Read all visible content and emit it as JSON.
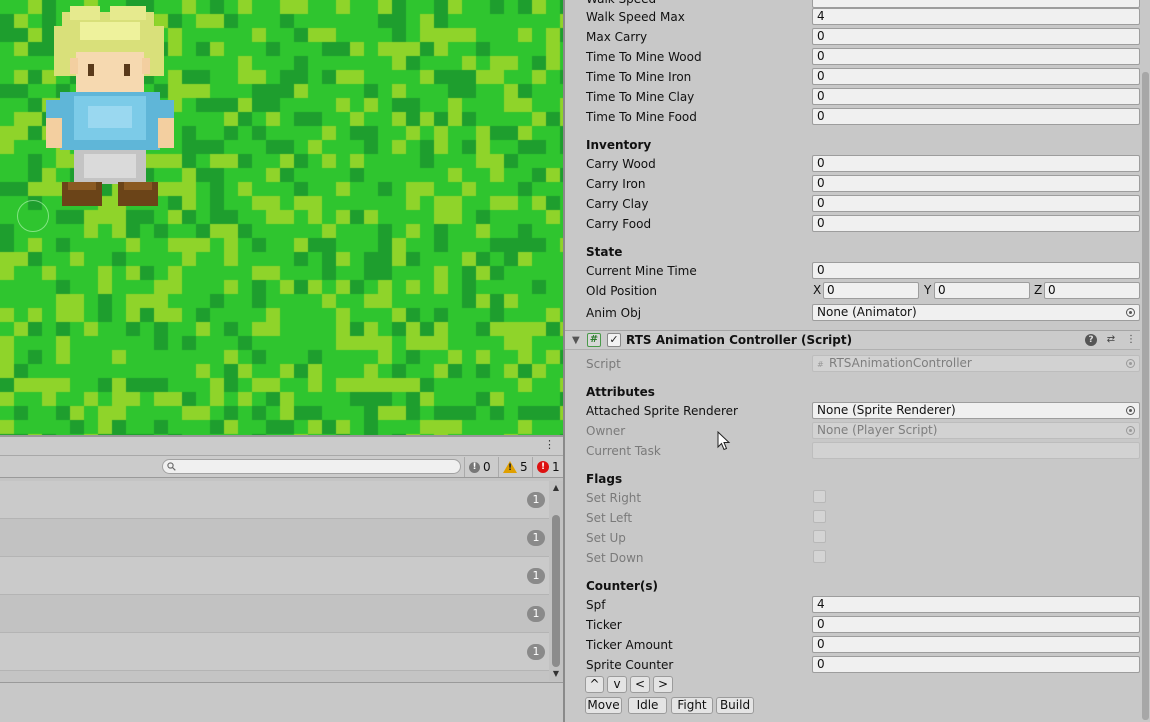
{
  "scene": {
    "colors": {
      "grass_base": "#2fc52f",
      "grass_light": "#8fd42a",
      "grass_dark": "#1e9e2e"
    }
  },
  "console": {
    "search": {
      "placeholder": ""
    },
    "counts": {
      "info": "0",
      "warnings": "5",
      "errors": "1"
    },
    "rows": [
      {
        "count": "1"
      },
      {
        "count": "1"
      },
      {
        "count": "1"
      },
      {
        "count": "1"
      },
      {
        "count": "1"
      }
    ]
  },
  "inspector": {
    "top_fields": [
      {
        "label": "Walk Speed",
        "value": ""
      },
      {
        "label": "Walk Speed Max",
        "value": "4"
      },
      {
        "label": "Max Carry",
        "value": "0"
      },
      {
        "label": "Time To Mine Wood",
        "value": "0"
      },
      {
        "label": "Time To Mine Iron",
        "value": "0"
      },
      {
        "label": "Time To Mine Clay",
        "value": "0"
      },
      {
        "label": "Time To Mine Food",
        "value": "0"
      }
    ],
    "inventory": {
      "header": "Inventory",
      "fields": [
        {
          "label": "Carry Wood",
          "value": "0"
        },
        {
          "label": "Carry Iron",
          "value": "0"
        },
        {
          "label": "Carry Clay",
          "value": "0"
        },
        {
          "label": "Carry Food",
          "value": "0"
        }
      ]
    },
    "state": {
      "header": "State",
      "current_mine_time": {
        "label": "Current Mine Time",
        "value": "0"
      },
      "old_position": {
        "label": "Old Position",
        "x_label": "X",
        "x": "0",
        "y_label": "Y",
        "y": "0",
        "z_label": "Z",
        "z": "0"
      },
      "anim_obj": {
        "label": "Anim Obj",
        "value": "None (Animator)"
      }
    },
    "component": {
      "title": "RTS Animation Controller (Script)",
      "enabled": "✓",
      "script": {
        "label": "Script",
        "value": "RTSAnimationController"
      },
      "attributes": {
        "header": "Attributes",
        "attached_sprite_renderer": {
          "label": "Attached Sprite Renderer",
          "value": "None (Sprite Renderer)"
        },
        "owner": {
          "label": "Owner",
          "value": "None (Player Script)"
        },
        "current_task": {
          "label": "Current Task",
          "value": ""
        }
      },
      "flags": {
        "header": "Flags",
        "items": [
          {
            "label": "Set Right",
            "checked": false
          },
          {
            "label": "Set Left",
            "checked": false
          },
          {
            "label": "Set Up",
            "checked": false
          },
          {
            "label": "Set Down",
            "checked": false
          }
        ]
      },
      "counters": {
        "header": "Counter(s)",
        "fields": [
          {
            "label": "Spf",
            "value": "4"
          },
          {
            "label": "Ticker",
            "value": "0"
          },
          {
            "label": "Ticker Amount",
            "value": "0"
          },
          {
            "label": "Sprite Counter",
            "value": "0"
          }
        ]
      },
      "direction_buttons": [
        "^",
        "v",
        "<",
        ">"
      ],
      "action_buttons": [
        "Move",
        "Idle",
        "Fight",
        "Build"
      ]
    }
  }
}
